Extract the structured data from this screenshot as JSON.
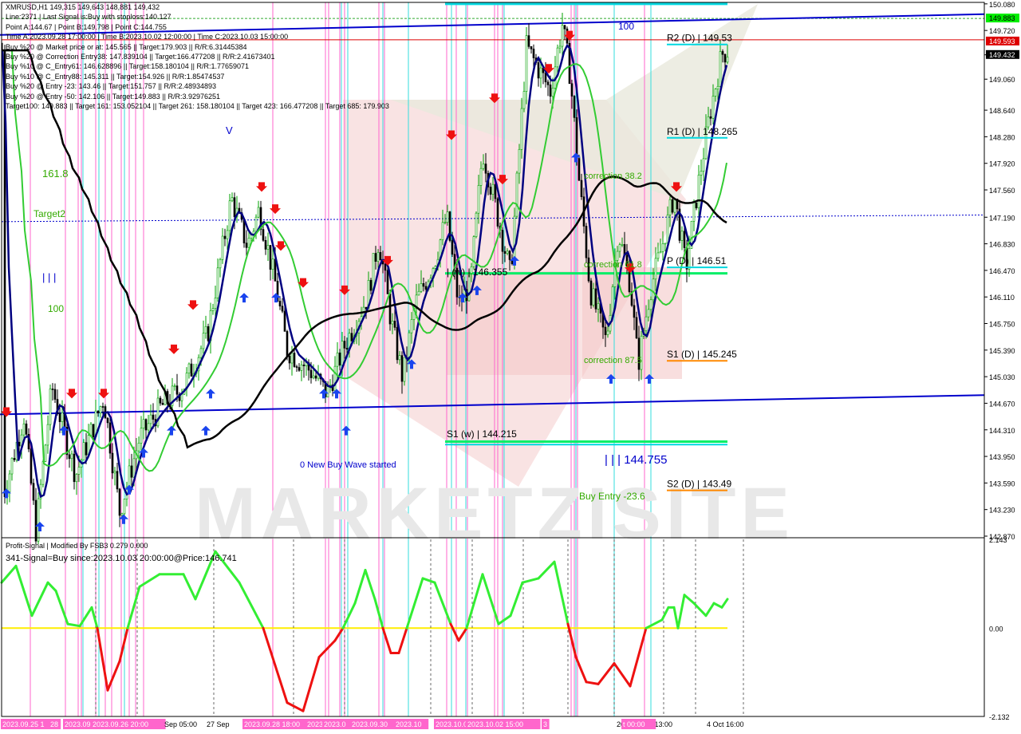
{
  "header": {
    "lines": [
      "XMRUSD,H1  149,315 149,643 148,881 149,432",
      "Line:2371  | Last Signal is:Buy with stoploss:140.127",
      "Point A:144.67 | Point B:149.798 | Point C:144.755",
      "Time A:2023.09.28 17:00:00 | Time B:2023.10.02 12:00:00 | Time C:2023.10.03 15:00:00",
      "Buy %20 @ Market price or at: 145.565 || Target:179.903 || R/R:6.31445384",
      "Buy %20 @ Correction Entry38: 147.839104 || Target:166.477208 || R/R:2.41673401",
      "Buy %10 @ C_Entry61: 146.628896 || Target:158.180104 || R/R:1.77659071",
      "Buy %10 @ C_Entry88: 145.311 || Target:154.926 || R/R:1.85474537",
      "Buy %20 @ Entry -23: 143.46 || Target:151.757 || R/R:2.48934893",
      "Buy %20 @ Entry -50: 142.106 || Target:149.883 || R/R:3.92976251",
      "Target100: 149.883 || Target 161: 153.052104 || Target 261: 158.180104 || Target 423: 166.477208 || Target 685: 179.903"
    ]
  },
  "chart_data": [
    {
      "type": "candlestick",
      "symbol": "XMRUSD",
      "timeframe": "H1",
      "ylim": [
        142.87,
        150.1
      ],
      "price_ticks": [
        "150.080",
        "149.720",
        "149.390",
        "149.060",
        "148.640",
        "148.280",
        "147.920",
        "147.560",
        "147.190",
        "146.830",
        "146.470",
        "146.110",
        "145.750",
        "145.390",
        "145.030",
        "144.670",
        "144.310",
        "143.950",
        "143.590",
        "143.230",
        "142.870"
      ],
      "time_labels": [
        "2023.09.25 1",
        "28",
        "2023.09",
        "2023.09.26 20:00",
        "Sep 05:00",
        "27 Sep",
        "2023.09.28 18:00",
        "2023.0",
        "2023.0",
        "2023.09.30",
        "2023.10",
        "2023.10.01 16:00",
        "2023.10.02 15:00",
        "3",
        "2023.10.03 13:00",
        "t 00:00",
        "4 Oct 16:00"
      ],
      "price_badges": [
        {
          "label": "149.883",
          "value": 149.883,
          "color": "#00ee00"
        },
        {
          "label": "149.593",
          "value": 149.593,
          "color": "#dd0000"
        },
        {
          "label": "149.432",
          "value": 149.432,
          "color": "#000000"
        }
      ],
      "levels": [
        {
          "label": "R2 (D) | 149.53",
          "value": 149.53,
          "color": "#00d8e0"
        },
        {
          "label": "R1 (D) | 148.265",
          "value": 148.265,
          "color": "#00d8e0"
        },
        {
          "label": "P (D) | 146.51",
          "value": 146.51,
          "color": "#00d8e0"
        },
        {
          "label": "S1 (D) | 145.245",
          "value": 145.245,
          "color": "#ff8800"
        },
        {
          "label": "S2 (D) | 143.49",
          "value": 143.49,
          "color": "#ff8800"
        }
      ],
      "annotations": [
        {
          "text": "161.8",
          "color": "#33aa00",
          "value": 147.9
        },
        {
          "text": "Target2",
          "color": "#33aa00",
          "value": 147.2
        },
        {
          "text": "| | |",
          "color": "#0000cc",
          "value": 146.3
        },
        {
          "text": "100",
          "color": "#33aa00",
          "value": 145.95
        },
        {
          "text": "100",
          "color": "#0000cc",
          "value": 149.85
        },
        {
          "text": "V",
          "color": "#0000cc",
          "value": 148.37
        },
        {
          "text": "correction 38.2",
          "color": "#33aa00",
          "value": 147.8
        },
        {
          "text": "correction 61.8",
          "color": "#33aa00",
          "value": 146.6
        },
        {
          "text": "correction 87.5",
          "color": "#33aa00",
          "value": 145.1
        },
        {
          "text": "| (w) | 146.355",
          "color": "#000000",
          "value": 146.45
        },
        {
          "text": "S1 (w) | 144.215",
          "color": "#000000",
          "value": 144.25
        },
        {
          "text": "| | | 144.755",
          "color": "#0000cc",
          "value": 143.8
        },
        {
          "text": "0 New Buy Wave started",
          "color": "#0000cc",
          "value": 143.8
        },
        {
          "text": "Buy Entry -23.6",
          "color": "#33aa00",
          "value": 143.35
        }
      ],
      "trend_lines": [
        {
          "name": "upper channel",
          "color": "#0000cc",
          "from": 149.66,
          "to": 149.94
        },
        {
          "name": "lower channel",
          "color": "#0000cc",
          "from": 144.52,
          "to": 144.78
        }
      ],
      "horizontal_lines": [
        {
          "value": 150.08,
          "color": "#00d8e0"
        },
        {
          "value": 146.43,
          "color": "#00ee66"
        },
        {
          "value": 144.15,
          "color": "#00ee66"
        },
        {
          "value": 144.11,
          "color": "#00d8e0"
        }
      ],
      "colors": {
        "bull": "#00a000",
        "bear": "#000000",
        "ma_fast": "#000080",
        "ma_mid": "#33cc33",
        "ma_slow": "#000000"
      },
      "watermark": "MARKETZISITE"
    },
    {
      "type": "line",
      "title": "Profit-Signal | Modified By FSB3 0.279 0.000",
      "subtitle": "341-Signal=Buy since:2023.10.03 20:00:00@Price:146.741",
      "ylim": [
        -2.132,
        2.143
      ],
      "y_ticks": [
        "2.143",
        "0.00",
        "-2.132"
      ],
      "zero_line_color": "#ffee00",
      "colors": {
        "positive": "#33ee33",
        "negative": "#ee1111"
      }
    }
  ]
}
